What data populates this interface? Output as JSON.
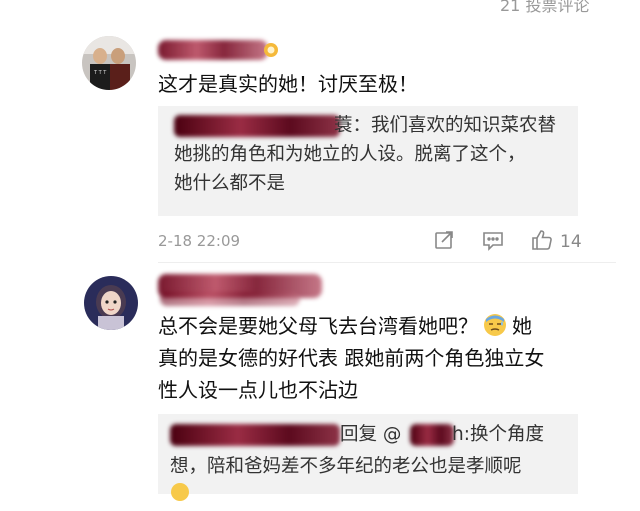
{
  "top_fragment": "21 投票评论",
  "comments": [
    {
      "text": "这才是真实的她！讨厌至极！",
      "reply_text_line1": "蓑：我们喜欢的知识菜农替",
      "reply_text_line2": "她挑的角色和为她立的人设。脱离了这个，",
      "reply_text_line3": "她什么都不是",
      "timestamp": "2-18 22:09",
      "like_count": "14"
    },
    {
      "text_line1a": "总不会是要她父母飞去台湾看她吧？",
      "text_line1b": "她",
      "text_line2": "真的是女德的好代表 跟她前两个角色独立女",
      "text_line3": "性人设一点儿也不沾边",
      "reply_prefix": "回复 @",
      "reply_suffix": "h:换个角度",
      "reply_line2": "想，陪和爸妈差不多年纪的老公也是孝顺呢"
    }
  ],
  "icons": [
    "share-icon",
    "comment-icon",
    "thumbs-up-icon",
    "cold-sweat-emoji-icon",
    "avatar-photo",
    "avatar-cartoon"
  ]
}
